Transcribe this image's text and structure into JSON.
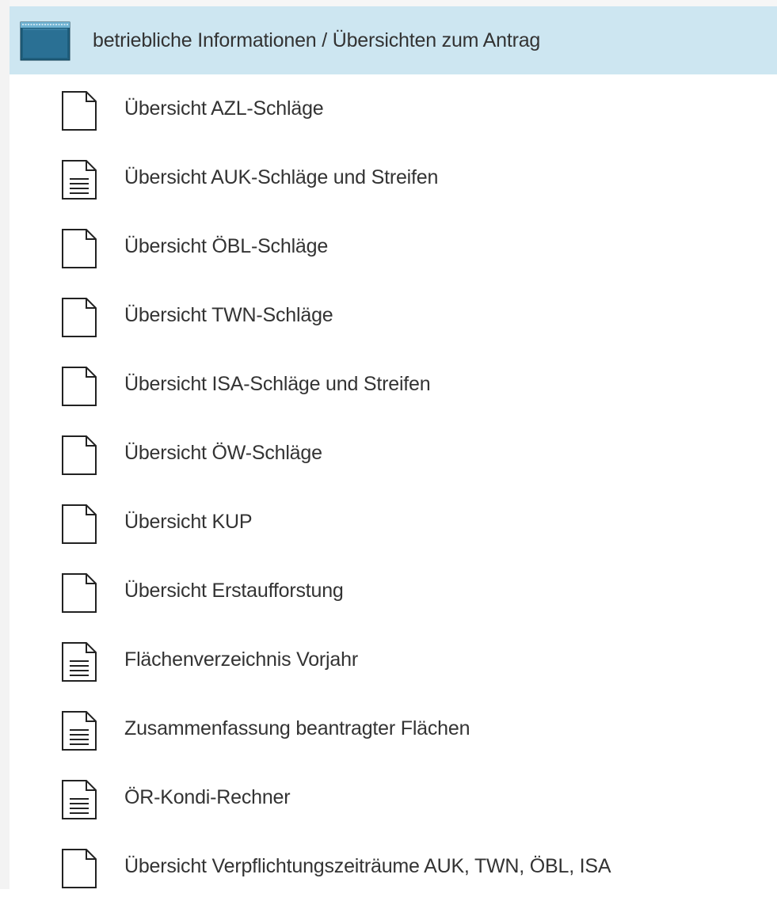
{
  "folder": {
    "title": "betriebliche Informationen / Übersichten zum Antrag",
    "icon": "folder-icon",
    "background": "#cde6f1",
    "items": [
      {
        "label": "Übersicht AZL-Schläge",
        "icon": "blank-document-icon",
        "has_lines": false
      },
      {
        "label": "Übersicht AUK-Schläge und Streifen",
        "icon": "text-document-icon",
        "has_lines": true
      },
      {
        "label": "Übersicht ÖBL-Schläge",
        "icon": "blank-document-icon",
        "has_lines": false
      },
      {
        "label": "Übersicht TWN-Schläge",
        "icon": "blank-document-icon",
        "has_lines": false
      },
      {
        "label": "Übersicht ISA-Schläge und Streifen",
        "icon": "blank-document-icon",
        "has_lines": false
      },
      {
        "label": "Übersicht ÖW-Schläge",
        "icon": "blank-document-icon",
        "has_lines": false
      },
      {
        "label": "Übersicht KUP",
        "icon": "blank-document-icon",
        "has_lines": false
      },
      {
        "label": "Übersicht Erstaufforstung",
        "icon": "blank-document-icon",
        "has_lines": false
      },
      {
        "label": "Flächenverzeichnis Vorjahr",
        "icon": "text-document-icon",
        "has_lines": true
      },
      {
        "label": "Zusammenfassung beantragter Flächen",
        "icon": "text-document-icon",
        "has_lines": true
      },
      {
        "label": "ÖR-Kondi-Rechner",
        "icon": "text-document-icon",
        "has_lines": true
      },
      {
        "label": "Übersicht Verpflichtungszeiträume AUK, TWN, ÖBL, ISA",
        "icon": "blank-document-icon",
        "has_lines": false
      }
    ]
  }
}
